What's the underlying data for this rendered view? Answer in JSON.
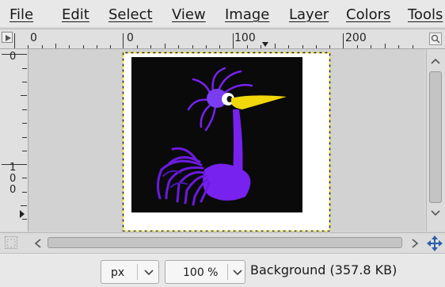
{
  "menu": {
    "file": "File",
    "edit": "Edit",
    "select": "Select",
    "view": "View",
    "image": "Image",
    "layer": "Layer",
    "colors": "Colors",
    "tools": "Tools"
  },
  "ruler": {
    "h_labels": [
      "0",
      "100",
      "200"
    ],
    "v_labels": [
      "0",
      "1",
      "0",
      "0"
    ]
  },
  "status": {
    "unit": "px",
    "zoom": "100 %",
    "layer_info": "Background (357.8 KB)"
  },
  "icons": {
    "menu_toggle": "triangle-right-icon",
    "zoom_fit": "zoom-icon",
    "navigate": "move-icon",
    "quickmask": "quick-mask-icon"
  },
  "colors": {
    "bird": "#7722ee",
    "beak": "#f2d70a",
    "canvas_bg": "#0a0a0a",
    "selection": "#f2e200"
  }
}
